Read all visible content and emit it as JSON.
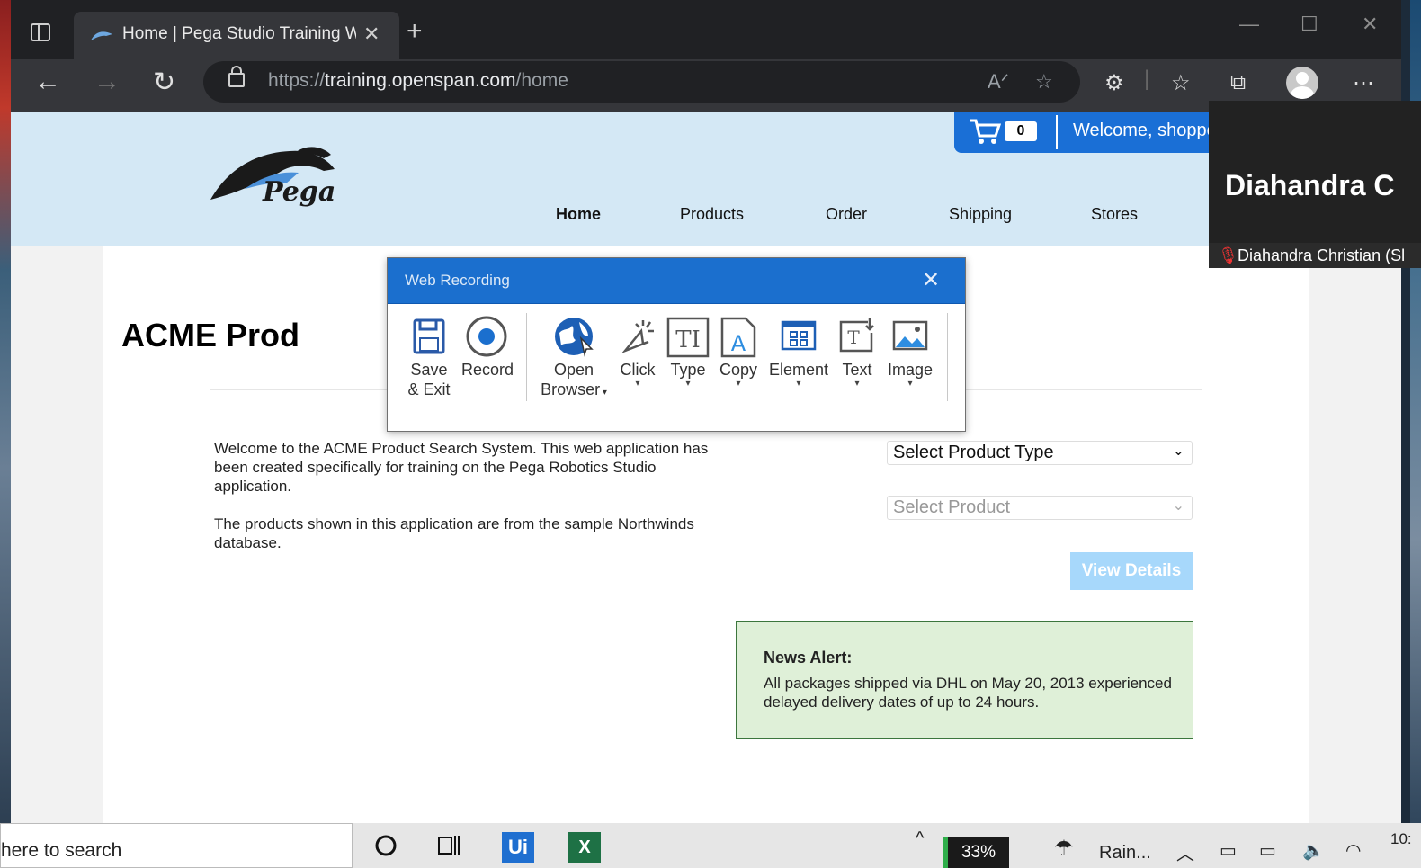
{
  "browser": {
    "tab_title": "Home | Pega Studio Training Web",
    "url_scheme": "https://",
    "url_host": "training.openspan.com",
    "url_path": "/home"
  },
  "site": {
    "logo_text": "Pega",
    "cart_count": "0",
    "welcome": "Welcome, shopper",
    "nav": [
      "Home",
      "Products",
      "Order",
      "Shipping",
      "Stores"
    ],
    "active_nav": "Home",
    "heading": "ACME Prod",
    "intro_p1": "Welcome to the ACME Product Search System. This web application has been created specifically for training on the Pega Robotics Studio application.",
    "intro_p2": "The products shown in this application are from the sample Northwinds database.",
    "select_type": "Select Product Type",
    "select_product": "Select Product",
    "view_details": "View Details",
    "news_title": "News Alert:",
    "news_body": "All packages shipped via DHL on May 20, 2013 experienced delayed delivery dates of up to 24 hours."
  },
  "recorder": {
    "title": "Web Recording",
    "tools": [
      {
        "label1": "Save",
        "label2": "& Exit"
      },
      {
        "label1": "Record"
      },
      {
        "label1": "Open",
        "label2": "Browser"
      },
      {
        "label1": "Click"
      },
      {
        "label1": "Type"
      },
      {
        "label1": "Copy"
      },
      {
        "label1": "Element"
      },
      {
        "label1": "Text"
      },
      {
        "label1": "Image"
      }
    ]
  },
  "zoom": {
    "name_big": "Diahandra  C",
    "name_small": "Diahandra Christian (Sl"
  },
  "taskbar": {
    "search": "here to search",
    "battery": "33%",
    "weather": "Rain...",
    "time": "10:"
  },
  "colors": {
    "recorder_blue": "#1b6fce",
    "header_bg": "#d4e8f5",
    "cart_blue": "#1a6fd6",
    "news_bg": "#dff0d8",
    "view_btn": "#a7d8fb"
  }
}
